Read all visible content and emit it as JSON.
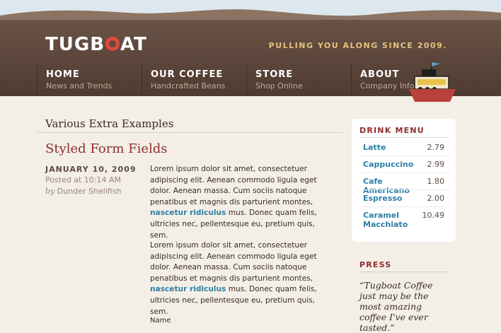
{
  "site": {
    "logo": "TUGBOAT",
    "tagline": "PULLING YOU ALONG SINCE 2009."
  },
  "nav": [
    {
      "title": "HOME",
      "subtitle": "News and Trends"
    },
    {
      "title": "OUR COFFEE",
      "subtitle": "Handcrafted Beans"
    },
    {
      "title": "STORE",
      "subtitle": "Shop Online"
    },
    {
      "title": "ABOUT",
      "subtitle": "Company Info"
    }
  ],
  "main": {
    "section_title": "Various Extra Examples",
    "post_title": "Styled Form Fields",
    "date": "JANUARY 10, 2009",
    "time": "Posted at 10:14 AM",
    "by": "by",
    "author": "Dunder Shellfish",
    "para_before_link": "Lorem ipsum dolor sit amet, consectetuer adipiscing elit. Aenean commodo ligula eget dolor. Aenean massa. Cum sociis natoque penatibus et magnis dis parturient montes, ",
    "link": "nascetur ridiculus",
    "para_after_link": " mus. Donec quam felis, ultricies nec, pellentesque eu, pretium quis, sem.",
    "name_label": "Name"
  },
  "drink_menu": {
    "heading": "DRINK MENU",
    "items": [
      {
        "name": "Latte",
        "price": "2.79"
      },
      {
        "name": "Cappuccino",
        "price": "2.99"
      },
      {
        "name": "Cafe Americano",
        "price": "1.80"
      },
      {
        "name": "Espresso",
        "price": "2.00"
      },
      {
        "name": "Caramel Macchiato",
        "price": "10.49"
      }
    ]
  },
  "press": {
    "heading": "PRESS",
    "quote": "“Tugboat Coffee just may be the most amazing coffee I've ever tasted.”"
  },
  "colors": {
    "header_brown": "#5c463b",
    "accent_red": "#8e2e2b",
    "link_blue": "#2e7fa6",
    "tagline_gold": "#e4c47e",
    "page_bg": "#f3efe6"
  },
  "icons": [
    "life-ring-icon",
    "tugboat-icon"
  ]
}
